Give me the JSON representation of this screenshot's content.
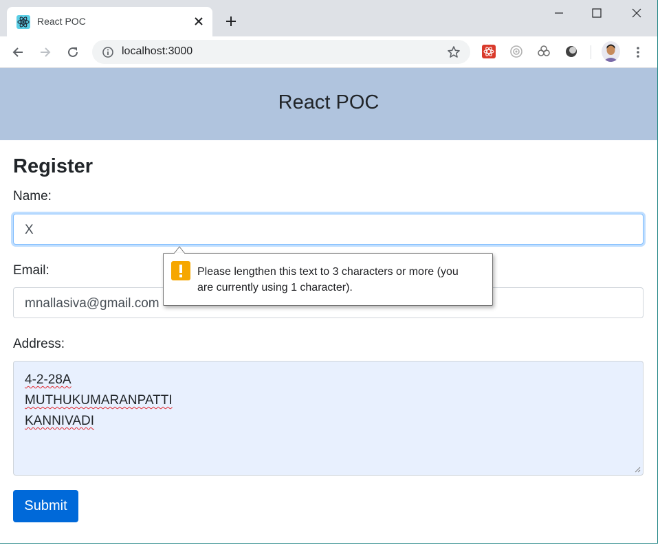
{
  "browser": {
    "tab_title": "React POC",
    "url": "localhost:3000"
  },
  "header": {
    "title": "React POC"
  },
  "form": {
    "title": "Register",
    "name_label": "Name:",
    "name_value": "X",
    "email_label": "Email:",
    "email_value": "mnallasiva@gmail.com",
    "address_label": "Address:",
    "address_lines": [
      "4-2-28A",
      "MUTHUKUMARANPATTI",
      "KANNIVADI"
    ],
    "submit_label": "Submit"
  },
  "validation_tooltip": {
    "line1": "Please lengthen this text to 3 characters or more (you",
    "line2": "are currently using 1 character)."
  },
  "colors": {
    "header_bg": "#b0c4de",
    "submit_bg": "#0069d9",
    "warning": "#f6a700",
    "autofill_bg": "#e8f0fe"
  }
}
